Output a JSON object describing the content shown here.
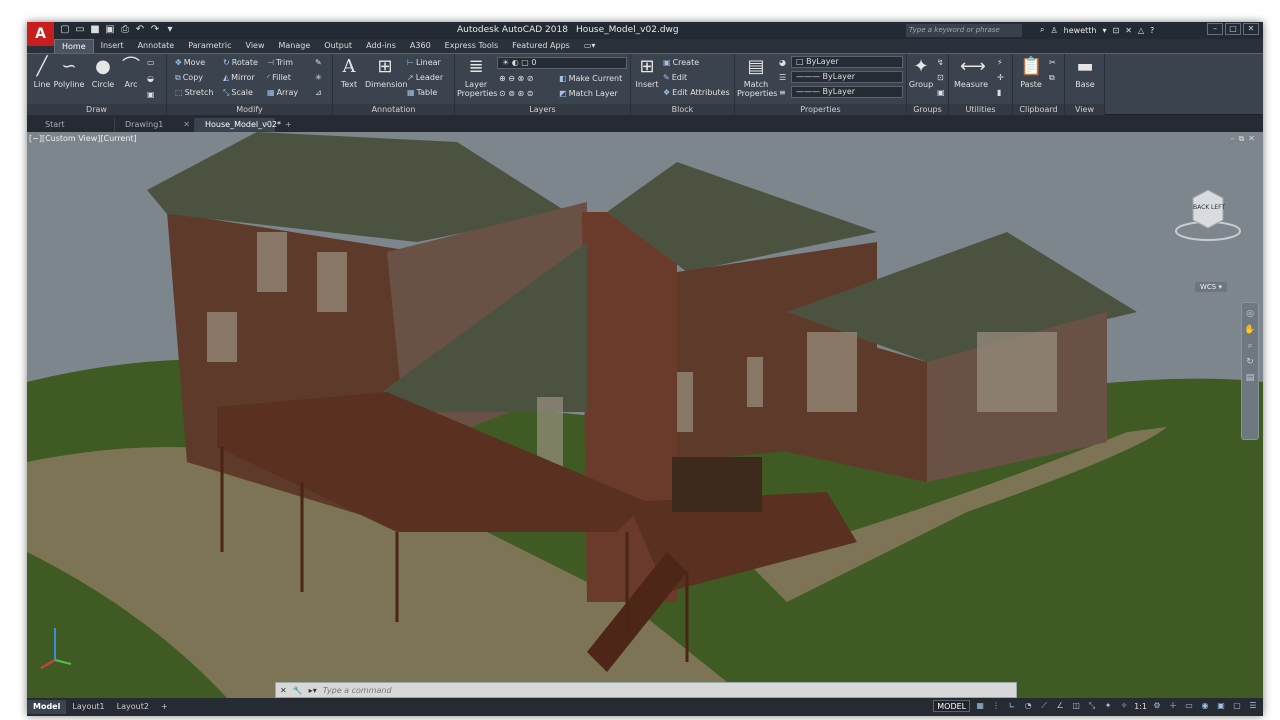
{
  "app": {
    "logo": "A",
    "title_app": "Autodesk AutoCAD 2018",
    "title_file": "House_Model_v02.dwg"
  },
  "search": {
    "placeholder": "Type a keyword or phrase"
  },
  "user": {
    "name": "hewetth"
  },
  "ribbon_tabs": [
    "Home",
    "Insert",
    "Annotate",
    "Parametric",
    "View",
    "Manage",
    "Output",
    "Add-ins",
    "A360",
    "Express Tools",
    "Featured Apps"
  ],
  "draw": {
    "title": "Draw",
    "line": "Line",
    "polyline": "Polyline",
    "circle": "Circle",
    "arc": "Arc"
  },
  "modify": {
    "title": "Modify",
    "move": "Move",
    "rotate": "Rotate",
    "trim": "Trim",
    "copy": "Copy",
    "mirror": "Mirror",
    "fillet": "Fillet",
    "stretch": "Stretch",
    "scale": "Scale",
    "array": "Array"
  },
  "annotation": {
    "title": "Annotation",
    "text": "Text",
    "dimension": "Dimension",
    "linear": "Linear",
    "leader": "Leader",
    "table": "Table"
  },
  "layers": {
    "title": "Layers",
    "layer_properties_1": "Layer",
    "layer_properties_2": "Properties",
    "current_layer": "0",
    "make_current": "Make Current",
    "match_layer": "Match Layer"
  },
  "block": {
    "title": "Block",
    "insert": "Insert",
    "create": "Create",
    "edit": "Edit",
    "edit_attributes": "Edit Attributes"
  },
  "properties": {
    "title": "Properties",
    "match_1": "Match",
    "match_2": "Properties",
    "color": "ByLayer",
    "linetype": "ByLayer",
    "lineweight": "ByLayer"
  },
  "groups": {
    "title": "Groups",
    "group": "Group"
  },
  "utilities": {
    "title": "Utilities",
    "measure": "Measure"
  },
  "clipboard": {
    "title": "Clipboard",
    "paste": "Paste"
  },
  "view_panel": {
    "title": "View",
    "base": "Base"
  },
  "doc_tabs": [
    {
      "label": "Start"
    },
    {
      "label": "Drawing1"
    },
    {
      "label": "House_Model_v02*"
    }
  ],
  "viewport": {
    "label": "[−][Custom View][Current]",
    "wcs": "WCS",
    "cube_back": "BACK",
    "cube_left": "LEFT"
  },
  "command": {
    "placeholder": "Type a command"
  },
  "layouts": [
    "Model",
    "Layout1",
    "Layout2"
  ],
  "status": {
    "model": "MODEL",
    "scale": "1:1"
  }
}
